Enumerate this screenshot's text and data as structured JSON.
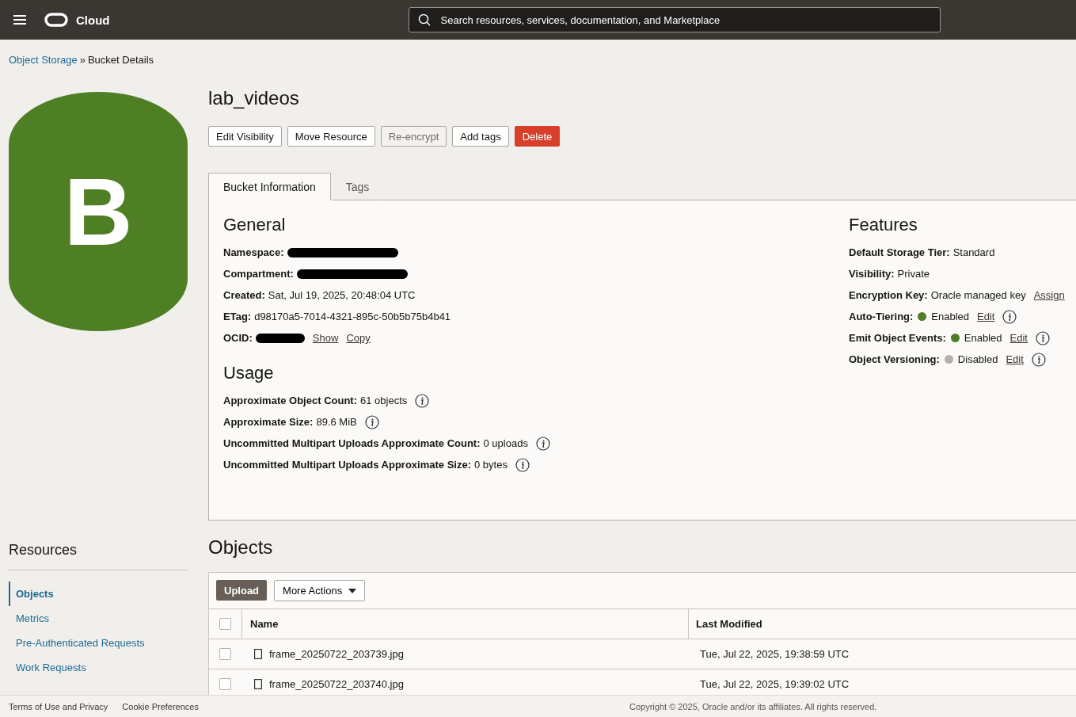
{
  "header": {
    "brand": "Cloud",
    "search": {
      "placeholder": "Search resources, services, documentation, and Marketplace"
    }
  },
  "breadcrumb": [
    {
      "label": "Object Storage",
      "kind": "link"
    },
    {
      "label": "Bucket Details",
      "kind": "current",
      "separator": "»"
    }
  ],
  "bucket": {
    "letter": "B",
    "name": "lab_videos"
  },
  "actions": [
    {
      "label": "Edit Visibility",
      "kind": "default",
      "disabled": false
    },
    {
      "label": "Move Resource",
      "kind": "default",
      "disabled": false
    },
    {
      "label": "Re-encrypt",
      "kind": "default",
      "disabled": true
    },
    {
      "label": "Add tags",
      "kind": "default",
      "disabled": false
    },
    {
      "label": "Delete",
      "kind": "danger",
      "disabled": false
    }
  ],
  "tabs": [
    {
      "label": "Bucket Information",
      "selected": true
    },
    {
      "label": "Tags",
      "selected": false
    }
  ],
  "general": {
    "title": "General",
    "rows": [
      {
        "label": "Namespace:",
        "kind": "redacted"
      },
      {
        "label": "Compartment:",
        "kind": "redacted"
      },
      {
        "label": "Created:",
        "kind": "text",
        "value": "Sat, Jul 19, 2025, 20:48:04 UTC"
      },
      {
        "label": "ETag:",
        "kind": "text",
        "value": "d98170a5-7014-4321-895c-50b5b75b4b41"
      },
      {
        "label": "OCID:",
        "kind": "redacted",
        "links": [
          "Show",
          "Copy"
        ]
      }
    ]
  },
  "usage": {
    "title": "Usage",
    "rows": [
      {
        "label": "Approximate Object Count:",
        "value": "61 objects",
        "info": true
      },
      {
        "label": "Approximate Size:",
        "value": "89.6 MiB",
        "info": true
      },
      {
        "label": "Uncommitted Multipart Uploads Approximate Count:",
        "value": "0 uploads",
        "info": true
      },
      {
        "label": "Uncommitted Multipart Uploads Approximate Size:",
        "value": "0 bytes",
        "info": true
      }
    ]
  },
  "features": {
    "title": "Features",
    "rows": [
      {
        "label": "Default Storage Tier:",
        "value": "Standard",
        "info": false
      },
      {
        "label": "Visibility:",
        "value": "Private",
        "info": false
      },
      {
        "label": "Encryption Key:",
        "value": "Oracle managed key",
        "link": "Assign",
        "info": false
      },
      {
        "label": "Auto-Tiering:",
        "value": "Enabled",
        "color": "#4f7f25",
        "link": "Edit",
        "info": true
      },
      {
        "label": "Emit Object Events:",
        "value": "Enabled",
        "color": "#4f7f25",
        "link": "Edit",
        "info": true
      },
      {
        "label": "Object Versioning:",
        "value": "Disabled",
        "color": "#b3b0ad",
        "link": "Edit",
        "info": true
      }
    ]
  },
  "resources": {
    "title": "Resources",
    "items": [
      {
        "label": "Objects",
        "selected": true
      },
      {
        "label": "Metrics",
        "selected": false
      },
      {
        "label": "Pre-Authenticated Requests",
        "selected": false
      },
      {
        "label": "Work Requests",
        "selected": false
      }
    ]
  },
  "objects": {
    "title": "Objects",
    "upload": "Upload",
    "more_actions": "More Actions",
    "columns": [
      "Name",
      "Last Modified"
    ],
    "all_checked": false,
    "rows": [
      {
        "name": "frame_20250722_203739.jpg",
        "modified": "Tue, Jul 22, 2025, 19:38:59 UTC",
        "checked": false
      },
      {
        "name": "frame_20250722_203740.jpg",
        "modified": "Tue, Jul 22, 2025, 19:39:02 UTC",
        "checked": false
      }
    ]
  },
  "footer": {
    "links": [
      "Terms of Use and Privacy",
      "Cookie Preferences"
    ],
    "copyright": "Copyright © 2025, Oracle and/or its affiliates. All rights reserved."
  }
}
